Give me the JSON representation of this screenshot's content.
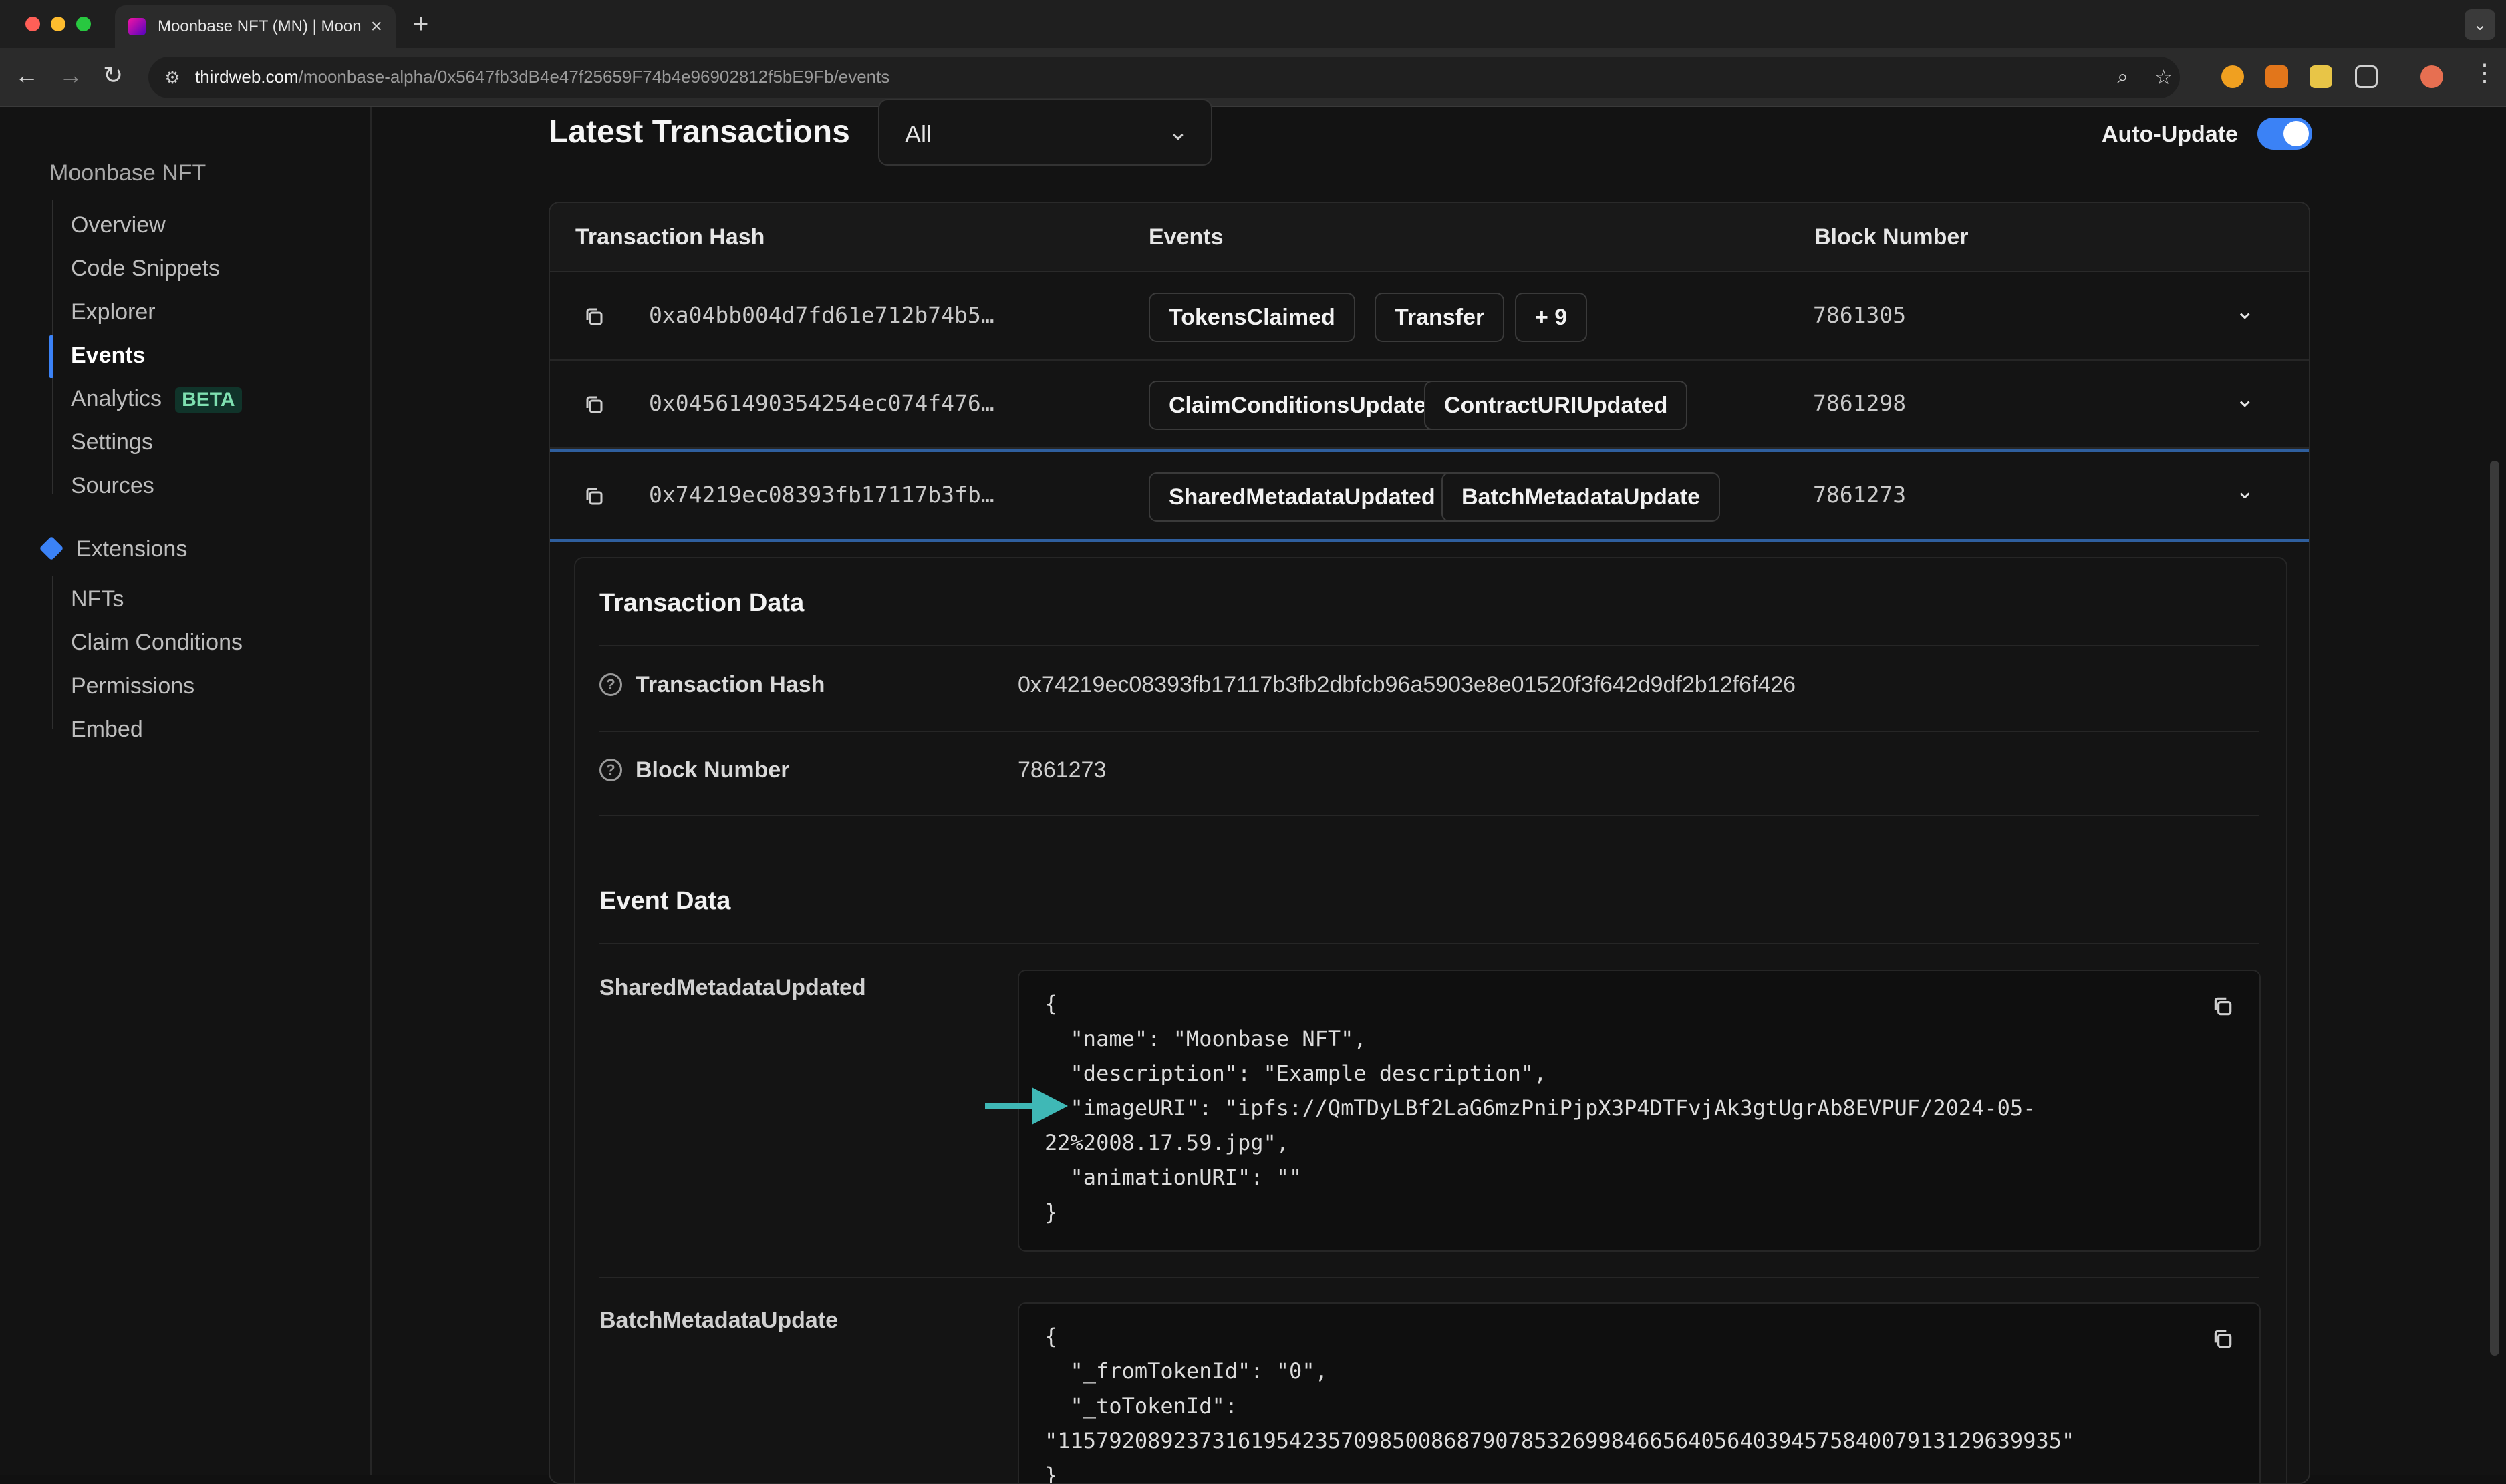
{
  "browser": {
    "tab_title": "Moonbase NFT (MN) | Moonbase",
    "tab_close": "×",
    "new_tab": "+",
    "url_host": "thirdweb.com",
    "url_path": "/moonbase-alpha/0x5647fb3dB4e47f25659F74b4e96902812f5bE9Fb/events"
  },
  "sidebar": {
    "contract_name": "Moonbase NFT",
    "items": [
      "Overview",
      "Code Snippets",
      "Explorer",
      "Events",
      "Analytics",
      "Settings",
      "Sources"
    ],
    "active_item": "Events",
    "analytics_badge": "BETA",
    "extensions_title": "Extensions",
    "extension_items": [
      "NFTs",
      "Claim Conditions",
      "Permissions",
      "Embed"
    ]
  },
  "header": {
    "title": "Latest Transactions",
    "filter_value": "All",
    "auto_update_label": "Auto-Update",
    "auto_update_on": true
  },
  "table": {
    "columns": [
      "Transaction Hash",
      "Events",
      "Block Number"
    ],
    "rows": [
      {
        "hash": "0xa04bb004d7fd61e712b74b5…",
        "events": [
          "TokensClaimed",
          "Transfer",
          "+ 9"
        ],
        "block": "7861305"
      },
      {
        "hash": "0x04561490354254ec074f476…",
        "events": [
          "ClaimConditionsUpdated",
          "ContractURIUpdated"
        ],
        "block": "7861298"
      },
      {
        "hash": "0x74219ec08393fb17117b3fb…",
        "events": [
          "SharedMetadataUpdated",
          "BatchMetadataUpdate"
        ],
        "block": "7861273"
      }
    ]
  },
  "detail": {
    "tx_data_title": "Transaction Data",
    "tx_hash_label": "Transaction Hash",
    "tx_hash_value": "0x74219ec08393fb17117b3fb2dbfcb96a5903e8e01520f3f642d9df2b12f6f426",
    "block_label": "Block Number",
    "block_value": "7861273",
    "event_data_title": "Event Data",
    "events": [
      {
        "name": "SharedMetadataUpdated",
        "lines": [
          "{",
          "  \"name\": \"Moonbase NFT\",",
          "  \"description\": \"Example description\",",
          "  \"imageURI\": \"ipfs://QmTDyLBf2LaG6mzPniPjpX3P4DTFvjAk3gtUgrAb8EVPUF/2024-05-",
          "22%2008.17.59.jpg\",",
          "  \"animationURI\": \"\"",
          "}"
        ]
      },
      {
        "name": "BatchMetadataUpdate",
        "lines": [
          "{",
          "  \"_fromTokenId\": \"0\",",
          "  \"_toTokenId\":",
          "\"115792089237316195423570985008687907853269984665640564039457584007913129639935\"",
          "}"
        ]
      }
    ]
  },
  "colors": {
    "accent": "#3b82f6",
    "annotation_arrow": "#3fb8b6",
    "beta_badge": "#7ee0b0"
  },
  "icons": [
    "copy-icon",
    "chevron-down-icon",
    "help-circle-icon",
    "diamond-icon",
    "search-icon",
    "star-icon",
    "puzzle-icon"
  ]
}
